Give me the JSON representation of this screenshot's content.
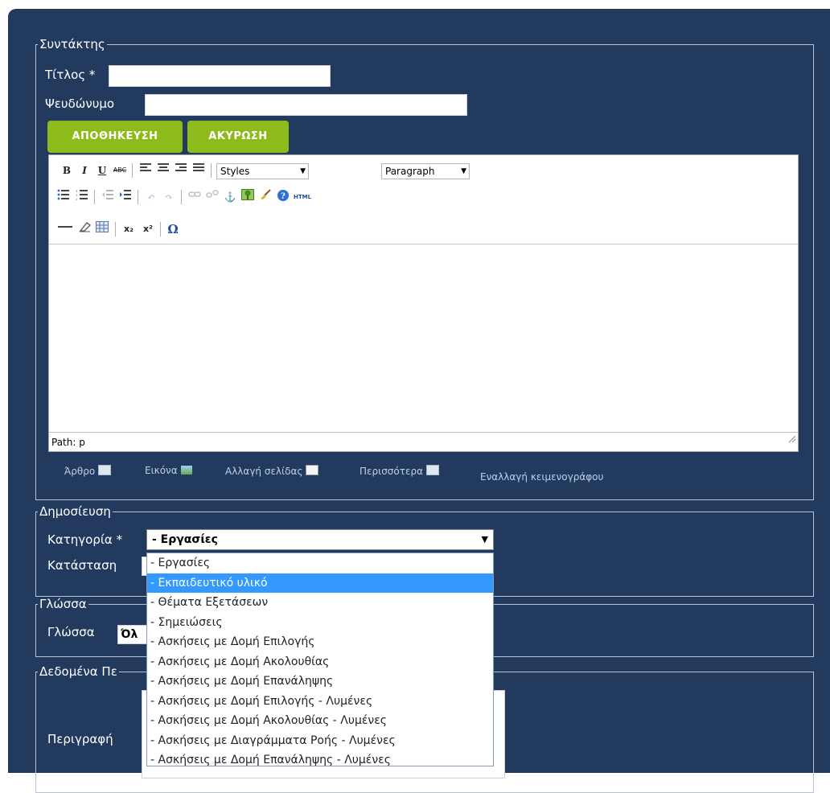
{
  "editor_section": {
    "legend": "Συντάκτης",
    "title_label": "Τίτλος *",
    "title_value": "",
    "alias_label": "Ψευδώνυμο",
    "alias_value": "",
    "save_label": "ΑΠΟΘΗΚΕΥΣΗ",
    "cancel_label": "ΑΚΥΡΩΣΗ"
  },
  "toolbar": {
    "styles_value": "Styles",
    "format_value": "Paragraph",
    "bold": "B",
    "italic": "I",
    "underline": "U",
    "strike": "ABC",
    "subscript": "x₂",
    "superscript": "x²",
    "omega": "Ω",
    "html": "HTML"
  },
  "path": {
    "text": "Path: p"
  },
  "extra_buttons": {
    "article": "Άρθρο",
    "image": "Εικόνα",
    "pagebreak": "Αλλαγή σελίδας",
    "readmore": "Περισσότερα",
    "toggle": "Εναλλαγή κειμενογράφου"
  },
  "publishing": {
    "legend": "Δημοσίευση",
    "category_label": "Κατηγορία *",
    "category_value": "- Εργασίες",
    "status_label": "Κατάσταση",
    "options": [
      "- Εργασίες",
      "- Εκπαιδευτικό υλικό",
      "- Θέματα Εξετάσεων",
      "- Σημειώσεις",
      "- Ασκήσεις με Δομή Επιλογής",
      "- Ασκήσεις με Δομή Ακολουθίας",
      "- Ασκήσεις με Δομή Επανάληψης",
      "- Ασκήσεις με Δομή Επιλογής - Λυμένες",
      "- Ασκήσεις με Δομή Ακολουθίας - Λυμένες",
      "- Ασκήσεις με Διαγράμματα Ροής - Λυμένες",
      "- Ασκήσεις με Δομή Επανάληψης - Λυμένες"
    ],
    "highlighted_index": 1
  },
  "language": {
    "legend": "Γλώσσα",
    "label": "Γλώσσα",
    "value": "Όλ"
  },
  "metadata": {
    "legend": "Δεδομένα Πε",
    "description_label": "Περιγραφή"
  },
  "colors": {
    "panel_bg": "#223a5e",
    "button_green": "#8dbb1c",
    "highlight": "#3399ff"
  }
}
